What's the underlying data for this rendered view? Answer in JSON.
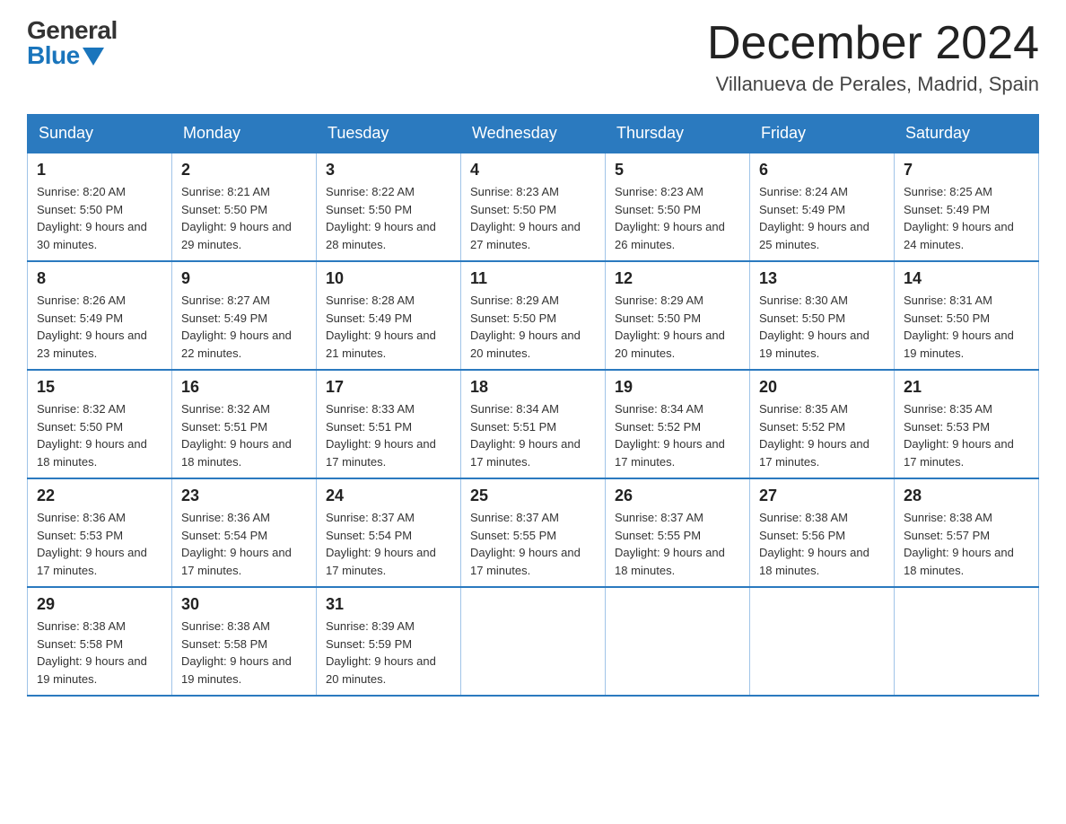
{
  "logo": {
    "general": "General",
    "blue": "Blue"
  },
  "title": "December 2024",
  "subtitle": "Villanueva de Perales, Madrid, Spain",
  "days_of_week": [
    "Sunday",
    "Monday",
    "Tuesday",
    "Wednesday",
    "Thursday",
    "Friday",
    "Saturday"
  ],
  "weeks": [
    [
      {
        "day": "1",
        "sunrise": "8:20 AM",
        "sunset": "5:50 PM",
        "daylight": "9 hours and 30 minutes."
      },
      {
        "day": "2",
        "sunrise": "8:21 AM",
        "sunset": "5:50 PM",
        "daylight": "9 hours and 29 minutes."
      },
      {
        "day": "3",
        "sunrise": "8:22 AM",
        "sunset": "5:50 PM",
        "daylight": "9 hours and 28 minutes."
      },
      {
        "day": "4",
        "sunrise": "8:23 AM",
        "sunset": "5:50 PM",
        "daylight": "9 hours and 27 minutes."
      },
      {
        "day": "5",
        "sunrise": "8:23 AM",
        "sunset": "5:50 PM",
        "daylight": "9 hours and 26 minutes."
      },
      {
        "day": "6",
        "sunrise": "8:24 AM",
        "sunset": "5:49 PM",
        "daylight": "9 hours and 25 minutes."
      },
      {
        "day": "7",
        "sunrise": "8:25 AM",
        "sunset": "5:49 PM",
        "daylight": "9 hours and 24 minutes."
      }
    ],
    [
      {
        "day": "8",
        "sunrise": "8:26 AM",
        "sunset": "5:49 PM",
        "daylight": "9 hours and 23 minutes."
      },
      {
        "day": "9",
        "sunrise": "8:27 AM",
        "sunset": "5:49 PM",
        "daylight": "9 hours and 22 minutes."
      },
      {
        "day": "10",
        "sunrise": "8:28 AM",
        "sunset": "5:49 PM",
        "daylight": "9 hours and 21 minutes."
      },
      {
        "day": "11",
        "sunrise": "8:29 AM",
        "sunset": "5:50 PM",
        "daylight": "9 hours and 20 minutes."
      },
      {
        "day": "12",
        "sunrise": "8:29 AM",
        "sunset": "5:50 PM",
        "daylight": "9 hours and 20 minutes."
      },
      {
        "day": "13",
        "sunrise": "8:30 AM",
        "sunset": "5:50 PM",
        "daylight": "9 hours and 19 minutes."
      },
      {
        "day": "14",
        "sunrise": "8:31 AM",
        "sunset": "5:50 PM",
        "daylight": "9 hours and 19 minutes."
      }
    ],
    [
      {
        "day": "15",
        "sunrise": "8:32 AM",
        "sunset": "5:50 PM",
        "daylight": "9 hours and 18 minutes."
      },
      {
        "day": "16",
        "sunrise": "8:32 AM",
        "sunset": "5:51 PM",
        "daylight": "9 hours and 18 minutes."
      },
      {
        "day": "17",
        "sunrise": "8:33 AM",
        "sunset": "5:51 PM",
        "daylight": "9 hours and 17 minutes."
      },
      {
        "day": "18",
        "sunrise": "8:34 AM",
        "sunset": "5:51 PM",
        "daylight": "9 hours and 17 minutes."
      },
      {
        "day": "19",
        "sunrise": "8:34 AM",
        "sunset": "5:52 PM",
        "daylight": "9 hours and 17 minutes."
      },
      {
        "day": "20",
        "sunrise": "8:35 AM",
        "sunset": "5:52 PM",
        "daylight": "9 hours and 17 minutes."
      },
      {
        "day": "21",
        "sunrise": "8:35 AM",
        "sunset": "5:53 PM",
        "daylight": "9 hours and 17 minutes."
      }
    ],
    [
      {
        "day": "22",
        "sunrise": "8:36 AM",
        "sunset": "5:53 PM",
        "daylight": "9 hours and 17 minutes."
      },
      {
        "day": "23",
        "sunrise": "8:36 AM",
        "sunset": "5:54 PM",
        "daylight": "9 hours and 17 minutes."
      },
      {
        "day": "24",
        "sunrise": "8:37 AM",
        "sunset": "5:54 PM",
        "daylight": "9 hours and 17 minutes."
      },
      {
        "day": "25",
        "sunrise": "8:37 AM",
        "sunset": "5:55 PM",
        "daylight": "9 hours and 17 minutes."
      },
      {
        "day": "26",
        "sunrise": "8:37 AM",
        "sunset": "5:55 PM",
        "daylight": "9 hours and 18 minutes."
      },
      {
        "day": "27",
        "sunrise": "8:38 AM",
        "sunset": "5:56 PM",
        "daylight": "9 hours and 18 minutes."
      },
      {
        "day": "28",
        "sunrise": "8:38 AM",
        "sunset": "5:57 PM",
        "daylight": "9 hours and 18 minutes."
      }
    ],
    [
      {
        "day": "29",
        "sunrise": "8:38 AM",
        "sunset": "5:58 PM",
        "daylight": "9 hours and 19 minutes."
      },
      {
        "day": "30",
        "sunrise": "8:38 AM",
        "sunset": "5:58 PM",
        "daylight": "9 hours and 19 minutes."
      },
      {
        "day": "31",
        "sunrise": "8:39 AM",
        "sunset": "5:59 PM",
        "daylight": "9 hours and 20 minutes."
      },
      null,
      null,
      null,
      null
    ]
  ],
  "labels": {
    "sunrise": "Sunrise:",
    "sunset": "Sunset:",
    "daylight": "Daylight:"
  }
}
